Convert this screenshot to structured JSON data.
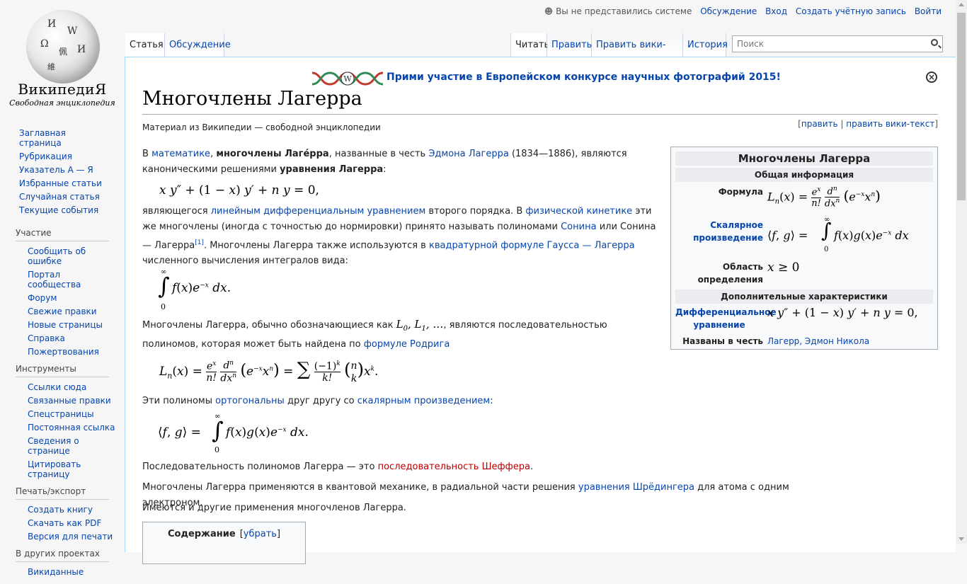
{
  "logo": {
    "title": "ВикипедиЯ",
    "subtitle": "Свободная энциклопедия"
  },
  "sidebar": {
    "nav": [
      "Заглавная страница",
      "Рубрикация",
      "Указатель А — Я",
      "Избранные статьи",
      "Случайная статья",
      "Текущие события"
    ],
    "participation": {
      "heading": "Участие",
      "items": [
        "Сообщить об ошибке",
        "Портал сообщества",
        "Форум",
        "Свежие правки",
        "Новые страницы",
        "Справка",
        "Пожертвования"
      ]
    },
    "tools": {
      "heading": "Инструменты",
      "items": [
        "Ссылки сюда",
        "Связанные правки",
        "Спецстраницы",
        "Постоянная ссылка",
        "Сведения о странице",
        "Цитировать страницу"
      ]
    },
    "print": {
      "heading": "Печать/экспорт",
      "items": [
        "Создать книгу",
        "Скачать как PDF",
        "Версия для печати"
      ]
    },
    "other": {
      "heading": "В других проектах",
      "items": [
        "Викиданные"
      ]
    }
  },
  "personal": {
    "anon": "Вы не представились системе",
    "talk": "Обсуждение",
    "login": "Вход",
    "create": "Создать учётную запись",
    "enter": "Войти"
  },
  "tabs": {
    "article": "Статья",
    "talk": "Обсуждение",
    "read": "Читать",
    "edit": "Править",
    "edit_source": "Править вики-текст",
    "history": "История"
  },
  "search": {
    "placeholder": "Поиск"
  },
  "banner": {
    "text": "Прими участие в Европейском конкурсе научных фотографий 2015!"
  },
  "page": {
    "title": "Многочлены Лагерра",
    "tagline": "Материал из Википедии — свободной энциклопедии",
    "edit": "править",
    "edit_source": "править вики-текст"
  },
  "article": {
    "p1_a": "В ",
    "p1_math": "математике",
    "p1_b": ", ",
    "p1_bold": "многочлены Лаге́рра",
    "p1_c": ", названные в честь ",
    "p1_name": "Эдмона Лагерра",
    "p1_d": " (1834—1886), являются каноническими решениями ",
    "p1_eq": "уравнения Лагерра",
    "p1_e": ":",
    "p2_a": "являющегося ",
    "p2_link1": "линейным дифференциальным уравнением",
    "p2_b": " второго порядка. В ",
    "p2_link2": "физической кинетике",
    "p2_c": " эти же многочлены (иногда с точностью до нормировки) принято называть полиномами ",
    "p2_link3": "Сонина",
    "p2_d": " или Сонина — Лагерра",
    "p2_ref": "[1]",
    "p2_e": ". Многочлены Лагерра также используются в ",
    "p2_link4": "квадратурной формуле Гаусса — Лагерра",
    "p2_f": " численного вычисления интегралов вида:",
    "p3_a": "Многочлены Лагерра, обычно обозначающиеся как ",
    "p3_b": ", являются последовательностью полиномов, которая может быть найдена по ",
    "p3_link": "формуле Родрига",
    "p4_a": "Эти полиномы ",
    "p4_link1": "ортогональны",
    "p4_b": " друг другу со ",
    "p4_link2": "скалярным произведением",
    "p4_c": ":",
    "p5_a": "Последовательность полиномов Лагерра — это ",
    "p5_link1": "последовательность",
    "p5_space": " ",
    "p5_link2": "Шеффера",
    "p5_b": ".",
    "p6_a": "Многочлены Лагерра применяются в квантовой механике, в радиальной части решения ",
    "p6_link": "уравнения Шрёдингера",
    "p6_b": " для атома с одним электроном.",
    "p7": "Имеются и другие применения многочленов Лагерра."
  },
  "infobox": {
    "title": "Многочлены Лагерра",
    "general": "Общая информация",
    "formula_k": "Формула",
    "inner_k": "Скалярное произведение",
    "domain_k": "Область определения",
    "extra": "Дополнительные характеристики",
    "diffeq_k": "Дифференциальное уравнение",
    "named_k": "Названы в честь",
    "named_v": "Лагерр, Эдмон Никола"
  },
  "toc": {
    "title": "Содержание",
    "toggle": "убрать"
  },
  "colors": {
    "link": "#0645ad",
    "redlink": "#ba0000",
    "border": "#a7d7f9"
  }
}
